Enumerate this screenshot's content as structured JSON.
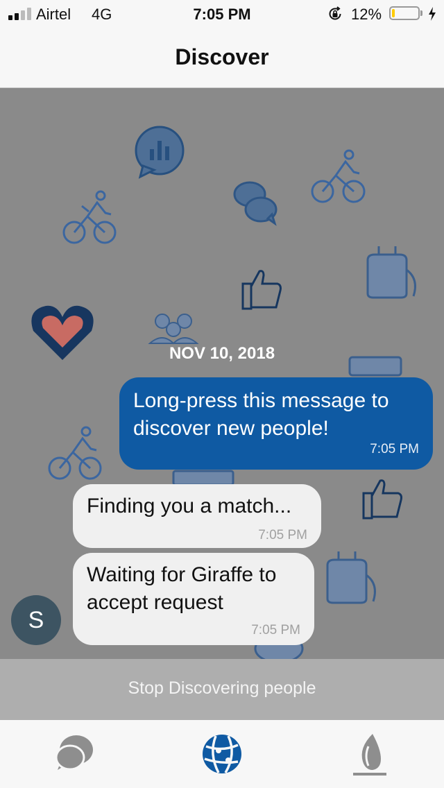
{
  "status_bar": {
    "carrier": "Airtel",
    "network": "4G",
    "time": "7:05 PM",
    "battery_percent": "12%",
    "battery_level": 0.12,
    "battery_color": "#ffcc00",
    "signal_bars_active": 2,
    "signal_bars_total": 4,
    "icons": [
      "signal-bars-icon",
      "rotation-lock-icon",
      "battery-icon",
      "charging-bolt-icon"
    ]
  },
  "header": {
    "title": "Discover"
  },
  "chat": {
    "date_label": "NOV 10, 2018",
    "messages": [
      {
        "direction": "outgoing",
        "text": "Long-press this message to discover new people!",
        "time": "7:05 PM"
      },
      {
        "direction": "incoming",
        "text": "Finding you a match...",
        "time": "7:05 PM"
      },
      {
        "direction": "incoming",
        "text": "Waiting for Giraffe to accept request",
        "time": "7:05 PM"
      }
    ],
    "avatar_letter": "S",
    "background_doodles": [
      "bar-chart-bubble-icon",
      "cyclist-icon",
      "chat-bubbles-icon",
      "backpack-icon",
      "thumbs-up-icon",
      "heart-icon",
      "group-icon",
      "suitcase-icon"
    ]
  },
  "action": {
    "stop_label": "Stop Discovering people"
  },
  "tab_bar": {
    "tabs": [
      {
        "name": "chats",
        "icon": "chat-bubbles-icon",
        "active": false
      },
      {
        "name": "discover",
        "icon": "globe-icon",
        "active": true
      },
      {
        "name": "profile",
        "icon": "flame-icon",
        "active": false
      }
    ]
  },
  "colors": {
    "accent": "#0f5aa3",
    "chat_background": "#8a8a8a",
    "incoming_bubble": "#f0f0f0",
    "avatar": "#3d5462",
    "stop_bar": "#aeaeae",
    "inactive_tab": "#8e8e8e"
  }
}
